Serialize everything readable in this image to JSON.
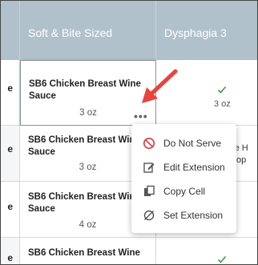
{
  "columns": {
    "left_partial": "",
    "soft_bite_sized": "Soft & Bite Sized",
    "dysphagia_3": "Dysphagia 3"
  },
  "rows": [
    {
      "left_text": "e",
      "item_name": "SB6 Chicken Breast Wine Sauce",
      "portion": "3 oz",
      "right_check": true,
      "right_text": "3 oz"
    },
    {
      "left_text": "e",
      "item_name": "SB6 Chicken Breast Wine Sauce",
      "portion": "3 oz",
      "right_check": false,
      "right_text_line1": "uce H",
      "right_text_line2": "op"
    },
    {
      "left_text": "e",
      "item_name": "SB6 Chicken Breast Wine Sauce",
      "portion": "4 oz",
      "right_check": false
    },
    {
      "left_text": "e",
      "item_name": "SB6 Chicken Breast Wine",
      "right_check": true
    }
  ],
  "more_button": "•••",
  "context_menu": [
    {
      "icon": "do-not-serve-icon",
      "label": "Do Not Serve"
    },
    {
      "icon": "edit-icon",
      "label": "Edit Extension"
    },
    {
      "icon": "copy-icon",
      "label": "Copy Cell"
    },
    {
      "icon": "set-extension-icon",
      "label": "Set Extension"
    }
  ],
  "colors": {
    "header_bg": "#b1c1cc",
    "check_green": "#3a9a4a",
    "arrow_red": "#e8433f",
    "do_not_serve_red": "#d9363e"
  }
}
